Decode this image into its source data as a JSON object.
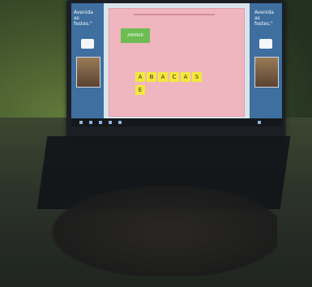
{
  "screen": {
    "left_sidebar_text": "Avenida\nas\nfestes.\"",
    "right_sidebar_text": "Avenida\nas\nfestes.\"",
    "green_button_label": "ANIMAR",
    "letters_row1": [
      "A",
      "B",
      "A",
      "C",
      "A",
      "S"
    ],
    "letters_row2": [
      "E"
    ]
  },
  "colors": {
    "sidebar": "#3e6f9e",
    "panel": "#efb6bf",
    "tile": "#f3e83b",
    "button": "#6dbd52"
  }
}
